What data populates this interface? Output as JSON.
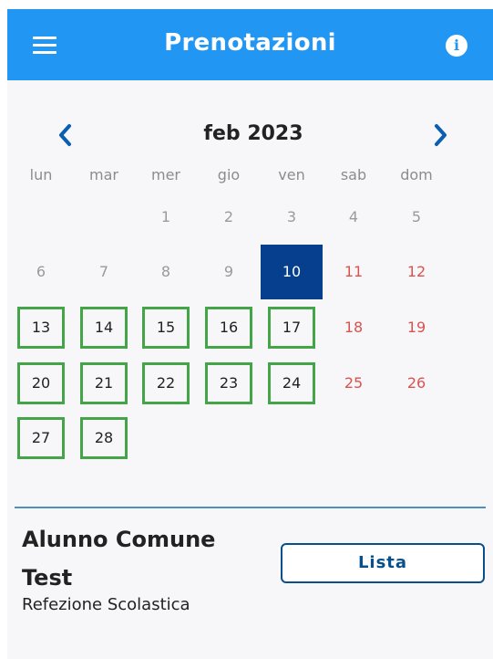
{
  "header": {
    "title": "Prenotazioni",
    "menu_icon": "hamburger-menu-icon",
    "info_icon": "info-icon",
    "info_glyph": "i",
    "color": "#2196f3"
  },
  "calendar": {
    "month_label": "feb 2023",
    "prev_icon": "chevron-left-icon",
    "next_icon": "chevron-right-icon",
    "weekdays": [
      "lun",
      "mar",
      "mer",
      "gio",
      "ven",
      "sab",
      "dom"
    ],
    "days": [
      {
        "label": "1",
        "state": "past"
      },
      {
        "label": "2",
        "state": "past"
      },
      {
        "label": "3",
        "state": "past"
      },
      {
        "label": "4",
        "state": "past"
      },
      {
        "label": "5",
        "state": "past"
      },
      {
        "label": "6",
        "state": "past"
      },
      {
        "label": "7",
        "state": "past"
      },
      {
        "label": "8",
        "state": "past"
      },
      {
        "label": "9",
        "state": "past"
      },
      {
        "label": "10",
        "state": "today"
      },
      {
        "label": "11",
        "state": "weekend"
      },
      {
        "label": "12",
        "state": "weekend"
      },
      {
        "label": "13",
        "state": "available"
      },
      {
        "label": "14",
        "state": "available"
      },
      {
        "label": "15",
        "state": "available"
      },
      {
        "label": "16",
        "state": "available"
      },
      {
        "label": "17",
        "state": "available"
      },
      {
        "label": "18",
        "state": "weekend"
      },
      {
        "label": "19",
        "state": "weekend"
      },
      {
        "label": "20",
        "state": "available"
      },
      {
        "label": "21",
        "state": "available"
      },
      {
        "label": "22",
        "state": "available"
      },
      {
        "label": "23",
        "state": "available"
      },
      {
        "label": "24",
        "state": "available"
      },
      {
        "label": "25",
        "state": "weekend"
      },
      {
        "label": "26",
        "state": "weekend"
      },
      {
        "label": "27",
        "state": "available"
      },
      {
        "label": "28",
        "state": "available"
      }
    ],
    "colors": {
      "today": "#063f8e",
      "available_border": "#43a547",
      "weekend": "#d9534f",
      "arrows": "#0b5fb0"
    }
  },
  "student": {
    "name": "Alunno Comune Test",
    "service": "Refezione Scolastica",
    "list_button": "Lista"
  }
}
